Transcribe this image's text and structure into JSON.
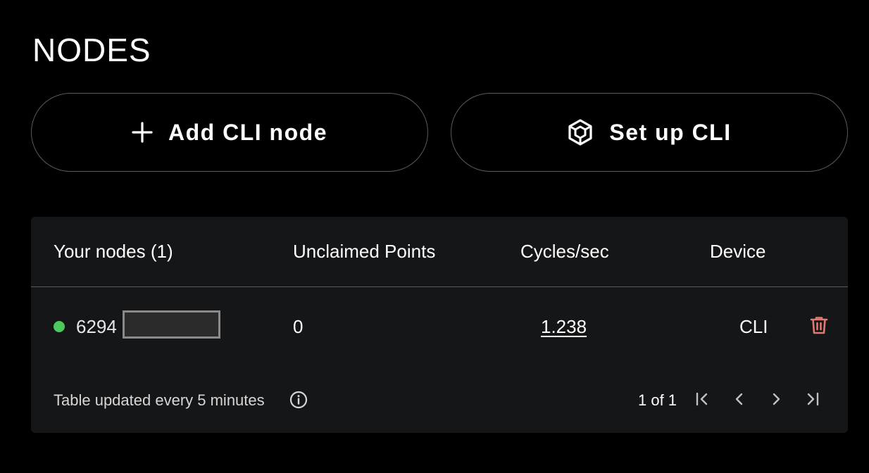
{
  "page": {
    "title": "NODES"
  },
  "actions": {
    "add_label": "Add CLI node",
    "setup_label": "Set up CLI"
  },
  "table": {
    "headers": {
      "nodes": "Your nodes (1)",
      "points": "Unclaimed Points",
      "cycles": "Cycles/sec",
      "device": "Device"
    },
    "rows": [
      {
        "id_prefix": "6294",
        "points": "0",
        "cycles": "1.238",
        "device": "CLI",
        "status": "online"
      }
    ],
    "footer_note": "Table updated every 5 minutes",
    "pagination": "1 of 1"
  },
  "colors": {
    "status_online": "#4cc95e",
    "delete": "#e07a6f",
    "card_bg": "#151618"
  },
  "icons": {
    "add": "plus-icon",
    "setup": "cube-icon",
    "delete": "trash-icon",
    "info": "info-icon",
    "first": "first-page-icon",
    "prev": "prev-page-icon",
    "next": "next-page-icon",
    "last": "last-page-icon"
  }
}
